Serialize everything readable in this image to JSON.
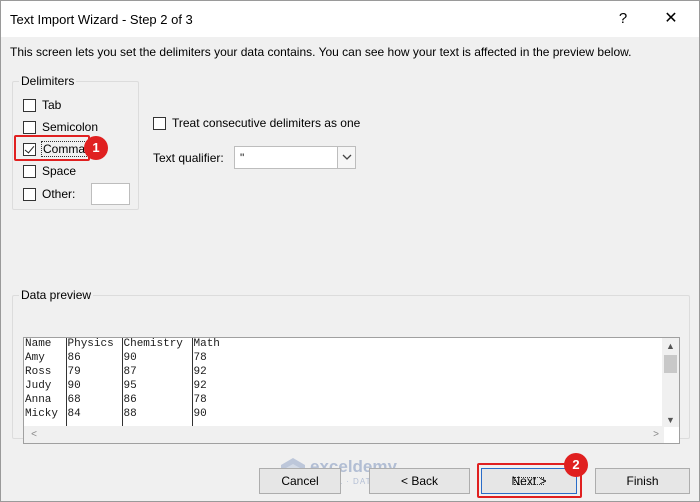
{
  "window": {
    "title": "Text Import Wizard - Step 2 of 3",
    "help_glyph": "?",
    "close_glyph": "✕"
  },
  "description": "This screen lets you set the delimiters your data contains.  You can see how your text is affected in the preview below.",
  "delimiters": {
    "group_label": "Delimiters",
    "options": [
      {
        "label": "Tab",
        "checked": false
      },
      {
        "label": "Semicolon",
        "checked": false
      },
      {
        "label": "Comma",
        "checked": true
      },
      {
        "label": "Space",
        "checked": false
      },
      {
        "label": "Other:",
        "checked": false
      }
    ],
    "other_value": ""
  },
  "treat_consecutive": {
    "label": "Treat consecutive delimiters as one",
    "checked": false
  },
  "text_qualifier": {
    "label": "Text qualifier:",
    "value": "\""
  },
  "data_preview": {
    "group_label": "Data preview",
    "columns": [
      "Name",
      "Physics",
      "Chemistry",
      "Math"
    ],
    "rows": [
      [
        "Amy",
        "86",
        "90",
        "78"
      ],
      [
        "Ross",
        "79",
        "87",
        "92"
      ],
      [
        "Judy",
        "90",
        "95",
        "92"
      ],
      [
        "Anna",
        "68",
        "86",
        "78"
      ],
      [
        "Micky",
        "84",
        "88",
        "90"
      ]
    ]
  },
  "buttons": {
    "cancel": "Cancel",
    "back": "< Back",
    "next": "Next >",
    "finish": "Finish"
  },
  "annotations": {
    "badge1": "1",
    "badge2": "2"
  },
  "watermark": {
    "name": "exceldemy",
    "tagline": "EXCEL · DATA · BI"
  },
  "colors": {
    "highlight": "#e02020",
    "focus_blue": "#2a6cc8"
  }
}
